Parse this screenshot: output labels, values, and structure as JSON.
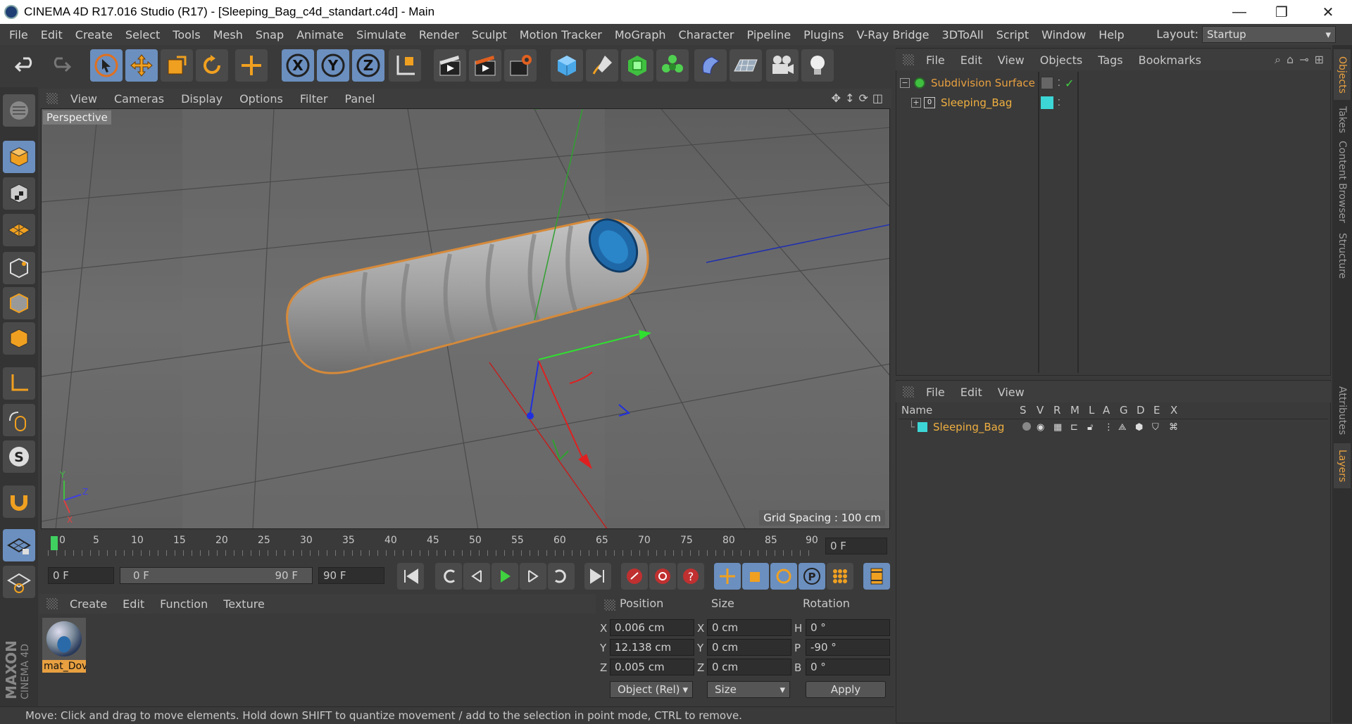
{
  "window": {
    "title": "CINEMA 4D R17.016 Studio (R17) - [Sleeping_Bag_c4d_standart.c4d] - Main",
    "minimize": "—",
    "restore": "❐",
    "close": "✕"
  },
  "menu": [
    "File",
    "Edit",
    "Create",
    "Select",
    "Tools",
    "Mesh",
    "Snap",
    "Animate",
    "Simulate",
    "Render",
    "Sculpt",
    "Motion Tracker",
    "MoGraph",
    "Character",
    "Pipeline",
    "Plugins",
    "V-Ray Bridge",
    "3DToAll",
    "Script",
    "Window",
    "Help"
  ],
  "layout": {
    "label": "Layout:",
    "value": "Startup"
  },
  "toolbar": {
    "x_label": "X",
    "y_label": "Y",
    "z_label": "Z"
  },
  "viewport": {
    "menu": [
      "View",
      "Cameras",
      "Display",
      "Options",
      "Filter",
      "Panel"
    ],
    "camera_label": "Perspective",
    "grid_spacing": "Grid Spacing : 100 cm",
    "axis_y": "Y",
    "axis_z": "Z",
    "axis_x": "X"
  },
  "timeline": {
    "ticks": [
      "0",
      "5",
      "10",
      "15",
      "20",
      "25",
      "30",
      "35",
      "40",
      "45",
      "50",
      "55",
      "60",
      "65",
      "70",
      "75",
      "80",
      "85",
      "90"
    ],
    "current_frame": "0 F",
    "start_frame": "0 F",
    "range_start": "0 F",
    "range_end": "90 F",
    "end_frame": "90 F"
  },
  "materials": {
    "menu": [
      "Create",
      "Edit",
      "Function",
      "Texture"
    ],
    "items": [
      {
        "name": "mat_Dov"
      }
    ]
  },
  "coords": {
    "headers": {
      "position": "Position",
      "size": "Size",
      "rotation": "Rotation"
    },
    "rows": [
      {
        "pos_axis": "X",
        "pos": "0.006 cm",
        "size_axis": "X",
        "size": "0 cm",
        "rot_axis": "H",
        "rot": "0 °"
      },
      {
        "pos_axis": "Y",
        "pos": "12.138 cm",
        "size_axis": "Y",
        "size": "0 cm",
        "rot_axis": "P",
        "rot": "-90 °"
      },
      {
        "pos_axis": "Z",
        "pos": "0.005 cm",
        "size_axis": "Z",
        "size": "0 cm",
        "rot_axis": "B",
        "rot": "0 °"
      }
    ],
    "mode": "Object (Rel)",
    "size_mode": "Size",
    "apply": "Apply"
  },
  "status": "Move: Click and drag to move elements. Hold down SHIFT to quantize movement / add to the selection in point mode, CTRL to remove.",
  "objects": {
    "menu": [
      "File",
      "Edit",
      "View",
      "Objects",
      "Tags",
      "Bookmarks"
    ],
    "items": [
      {
        "name": "Subdivision Surface",
        "color": "#e8a040"
      },
      {
        "name": "Sleeping_Bag",
        "color": "#f0b040"
      }
    ]
  },
  "layers": {
    "menu": [
      "File",
      "Edit",
      "View"
    ],
    "columns": [
      "Name",
      "S",
      "V",
      "R",
      "M",
      "L",
      "A",
      "G",
      "D",
      "E",
      "X"
    ],
    "items": [
      {
        "name": "Sleeping_Bag",
        "color": "#3dd6d6"
      }
    ]
  },
  "right_tabs": [
    "Objects",
    "Takes",
    "Content Browser",
    "Structure",
    "Attributes",
    "Layers"
  ],
  "brand": {
    "line1": "MAXON",
    "line2": "CINEMA 4D"
  },
  "colors": {
    "accent": "#e8a040",
    "selected": "#6b8fbf",
    "layer": "#3dd6d6"
  }
}
